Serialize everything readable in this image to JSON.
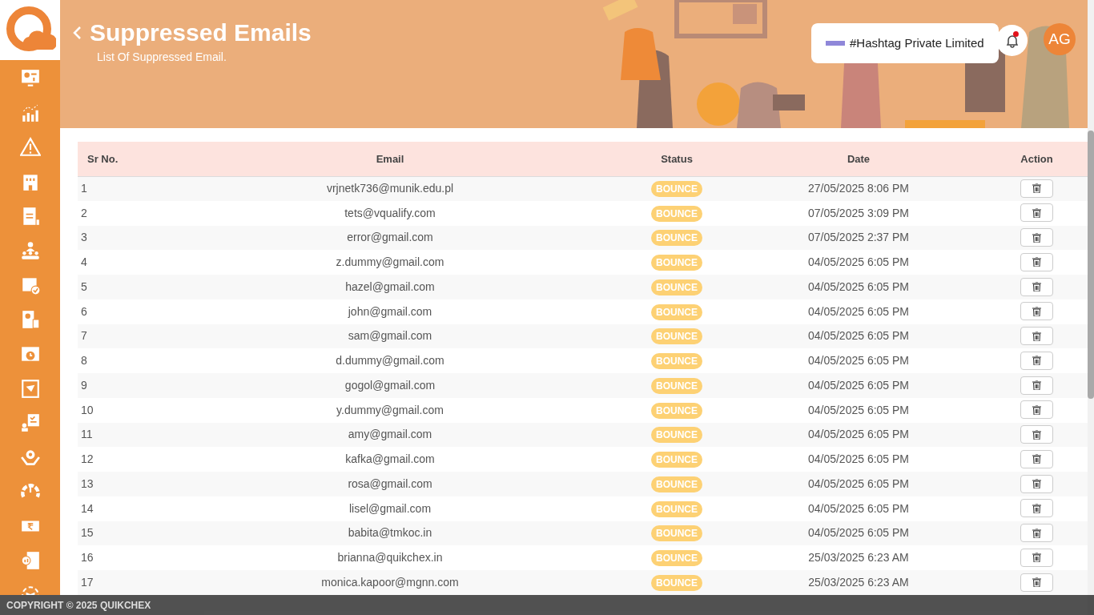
{
  "header": {
    "title": "Suppressed Emails",
    "subtitle": "List Of Suppressed Email."
  },
  "company": {
    "name": "#Hashtag Private Limited"
  },
  "notifications": {
    "unread": true
  },
  "avatar": {
    "initials": "AG"
  },
  "table": {
    "columns": [
      "Sr No.",
      "Email",
      "Status",
      "Date",
      "Action"
    ],
    "rows": [
      {
        "sr": "1",
        "email": "vrjnetk736@munik.edu.pl",
        "status": "BOUNCE",
        "date": "27/05/2025 8:06 PM"
      },
      {
        "sr": "2",
        "email": "tets@vqualify.com",
        "status": "BOUNCE",
        "date": "07/05/2025 3:09 PM"
      },
      {
        "sr": "3",
        "email": "error@gmail.com",
        "status": "BOUNCE",
        "date": "07/05/2025 2:37 PM"
      },
      {
        "sr": "4",
        "email": "z.dummy@gmail.com",
        "status": "BOUNCE",
        "date": "04/05/2025 6:05 PM"
      },
      {
        "sr": "5",
        "email": "hazel@gmail.com",
        "status": "BOUNCE",
        "date": "04/05/2025 6:05 PM"
      },
      {
        "sr": "6",
        "email": "john@gmail.com",
        "status": "BOUNCE",
        "date": "04/05/2025 6:05 PM"
      },
      {
        "sr": "7",
        "email": "sam@gmail.com",
        "status": "BOUNCE",
        "date": "04/05/2025 6:05 PM"
      },
      {
        "sr": "8",
        "email": "d.dummy@gmail.com",
        "status": "BOUNCE",
        "date": "04/05/2025 6:05 PM"
      },
      {
        "sr": "9",
        "email": "gogol@gmail.com",
        "status": "BOUNCE",
        "date": "04/05/2025 6:05 PM"
      },
      {
        "sr": "10",
        "email": "y.dummy@gmail.com",
        "status": "BOUNCE",
        "date": "04/05/2025 6:05 PM"
      },
      {
        "sr": "11",
        "email": "amy@gmail.com",
        "status": "BOUNCE",
        "date": "04/05/2025 6:05 PM"
      },
      {
        "sr": "12",
        "email": "kafka@gmail.com",
        "status": "BOUNCE",
        "date": "04/05/2025 6:05 PM"
      },
      {
        "sr": "13",
        "email": "rosa@gmail.com",
        "status": "BOUNCE",
        "date": "04/05/2025 6:05 PM"
      },
      {
        "sr": "14",
        "email": "lisel@gmail.com",
        "status": "BOUNCE",
        "date": "04/05/2025 6:05 PM"
      },
      {
        "sr": "15",
        "email": "babita@tmkoc.in",
        "status": "BOUNCE",
        "date": "04/05/2025 6:05 PM"
      },
      {
        "sr": "16",
        "email": "brianna@quikchex.in",
        "status": "BOUNCE",
        "date": "25/03/2025 6:23 AM"
      },
      {
        "sr": "17",
        "email": "monica.kapoor@mgnn.com",
        "status": "BOUNCE",
        "date": "25/03/2025 6:23 AM"
      }
    ]
  },
  "footer": {
    "text": "COPYRIGHT © 2025 QUIKCHEX"
  }
}
